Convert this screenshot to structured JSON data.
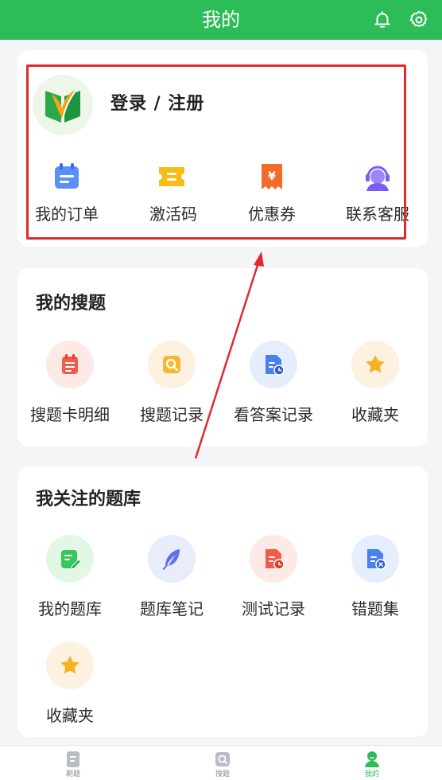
{
  "header": {
    "title": "我的"
  },
  "account": {
    "login_label": "登录 / 注册",
    "quick_actions": [
      {
        "label": "我的订单",
        "icon": "calendar-icon"
      },
      {
        "label": "激活码",
        "icon": "ticket-icon"
      },
      {
        "label": "优惠券",
        "icon": "coupon-icon"
      },
      {
        "label": "联系客服",
        "icon": "customer-service-icon"
      }
    ]
  },
  "my_search": {
    "title": "我的搜题",
    "items": [
      {
        "label": "搜题卡明细",
        "icon": "search-card-icon"
      },
      {
        "label": "搜题记录",
        "icon": "search-history-icon"
      },
      {
        "label": "看答案记录",
        "icon": "answer-history-icon"
      },
      {
        "label": "收藏夹",
        "icon": "star-icon"
      }
    ]
  },
  "question_banks": {
    "title": "我关注的题库",
    "items": [
      {
        "label": "我的题库",
        "icon": "edit-doc-icon"
      },
      {
        "label": "题库笔记",
        "icon": "feather-icon"
      },
      {
        "label": "测试记录",
        "icon": "test-record-icon"
      },
      {
        "label": "错题集",
        "icon": "wrong-questions-icon"
      },
      {
        "label": "收藏夹",
        "icon": "star-icon"
      }
    ]
  },
  "tabbar": {
    "tabs": [
      {
        "label": "刷题",
        "active": false
      },
      {
        "label": "搜题",
        "active": false
      },
      {
        "label": "我的",
        "active": true
      }
    ]
  },
  "colors": {
    "brand": "#2cbd58",
    "annotation": "#e02b2b"
  }
}
